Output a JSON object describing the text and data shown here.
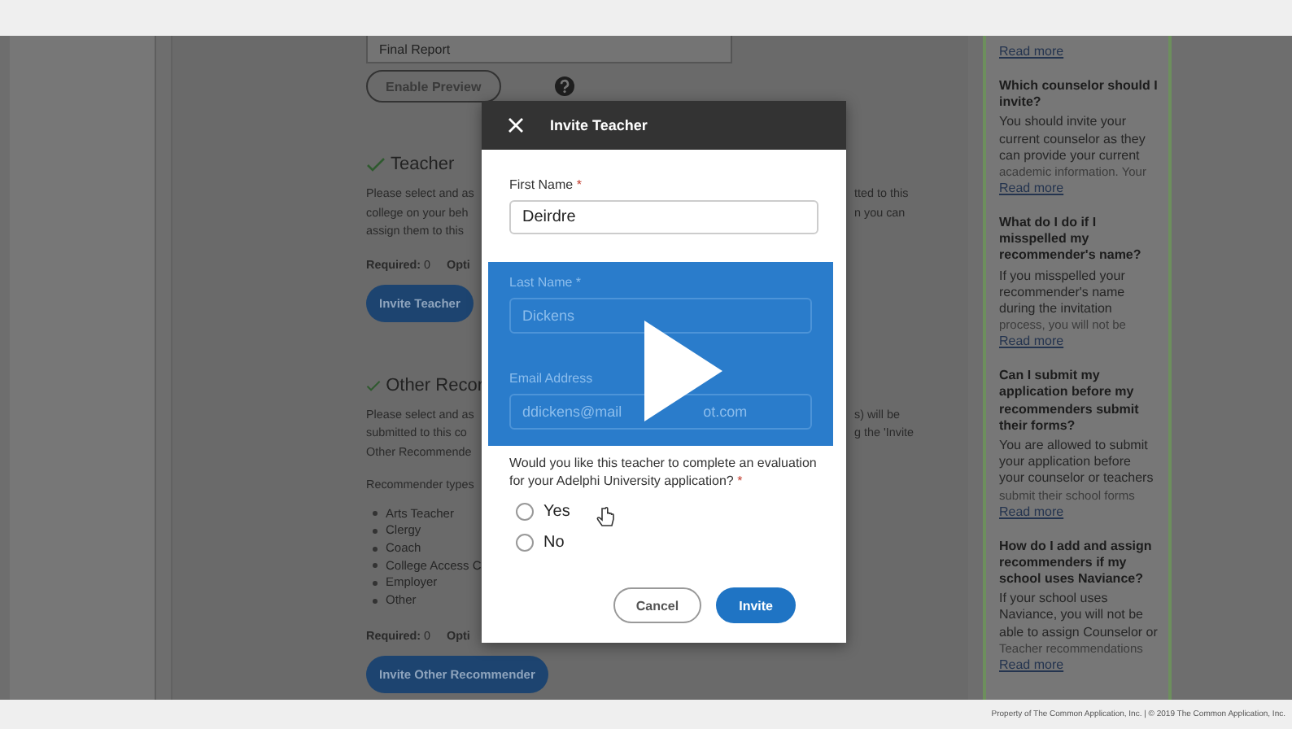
{
  "main": {
    "report_field": {
      "value": "Final Report"
    },
    "preview_button": "Enable Preview",
    "sections": [
      {
        "title": "Teacher",
        "complete": true,
        "left_lines": [
          "Please select and as",
          "college on your beh",
          "assign them to this"
        ],
        "right_lines": [
          "tted to this",
          "n you can"
        ],
        "required": "**Required:** 0",
        "optional": "Opti",
        "button": "Invite Teacher"
      },
      {
        "title": "Other Recor",
        "complete": true,
        "left_lines": [
          "Please select and as",
          "submitted to this co",
          "Other Recommende"
        ],
        "right_lines": [
          "s) will be",
          "g the 'Invite"
        ],
        "types_label": "Recommender types",
        "types": [
          "Arts Teacher",
          "Clergy",
          "Coach",
          "College Access C",
          "Employer",
          "Other"
        ],
        "required": "**Required:** 0",
        "optional": "Opti",
        "button": "Invite Other Recommender"
      }
    ]
  },
  "sidebar": {
    "top_read_more": "Read more",
    "faqs": [
      {
        "question": "Which counselor should I invite?",
        "answer": "You should invite your current counselor as they can provide your current",
        "faded": "academic information. Your",
        "read_more": "Read more"
      },
      {
        "question": "What do I do if I misspelled my recommender's name?",
        "answer": "If you misspelled your recommender's name during the invitation",
        "faded": "process, you will not be",
        "read_more": "Read more"
      },
      {
        "question": "Can I submit my application before my recommenders submit their forms?",
        "answer": "You are allowed to submit your application before your counselor or teachers",
        "faded": "submit their school forms",
        "read_more": "Read more"
      },
      {
        "question": "How do I add and assign recommenders if my school uses Naviance?",
        "answer": "If your school uses Naviance, you will not be able to assign Counselor or",
        "faded": "Teacher recommendations",
        "read_more": "Read more"
      }
    ]
  },
  "modal": {
    "title": "Invite Teacher",
    "first_name": {
      "label": "First Name",
      "required_mark": "*",
      "value": "Deirdre"
    },
    "covered_fields": [
      {
        "label": "Last Name *",
        "value_parts": [
          "Dickens"
        ]
      },
      {
        "label": "Email Address",
        "value_parts": [
          "ddickens@mail",
          "ot.com"
        ]
      }
    ],
    "question": {
      "text": "Would you like this teacher to complete an evaluation for your Adelphi University application?",
      "required_mark": "*"
    },
    "options": [
      {
        "label": "Yes",
        "selected": false
      },
      {
        "label": "No",
        "selected": false
      }
    ],
    "cancel_button": "Cancel",
    "invite_button": "Invite"
  },
  "footer": {
    "text": "Property of The Common Application, Inc. | © 2019 The Common Application, Inc."
  }
}
